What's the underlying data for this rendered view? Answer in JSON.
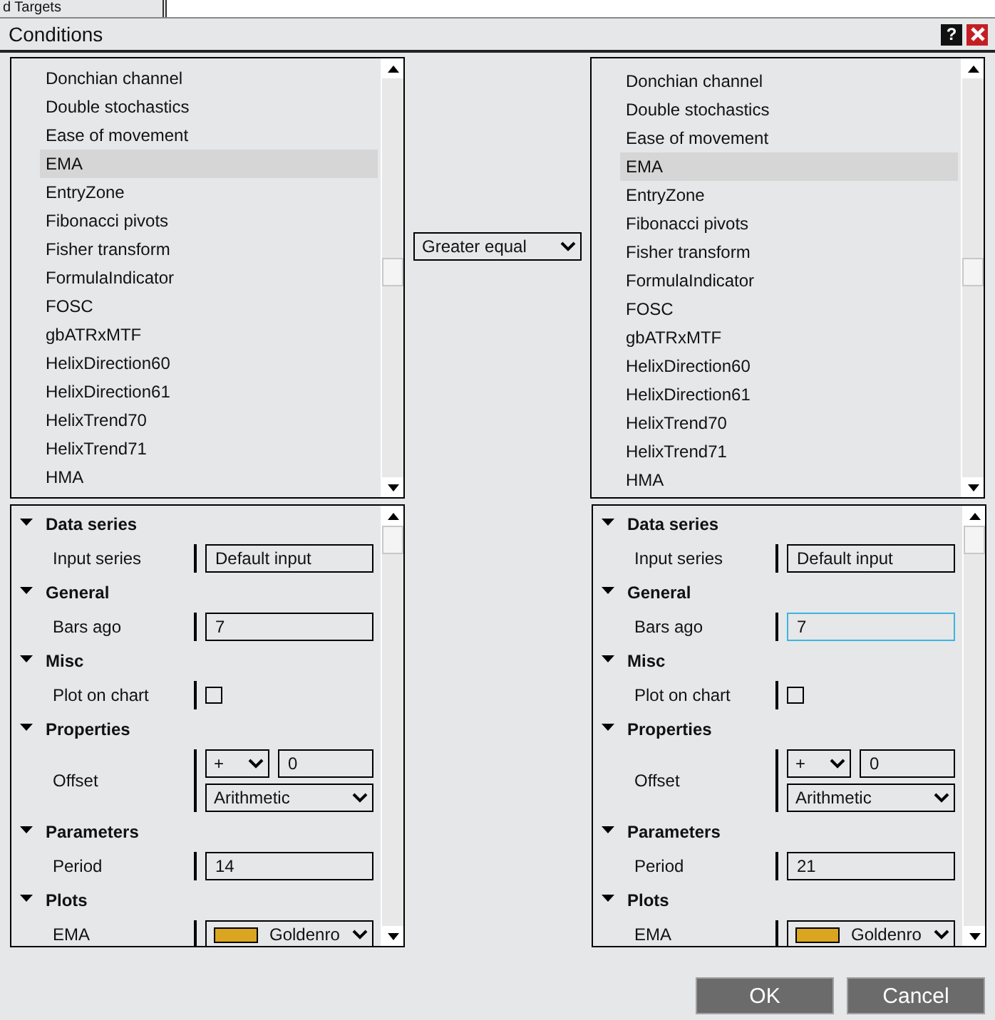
{
  "background_window": {
    "label": "d Targets"
  },
  "window": {
    "title": "Conditions",
    "help": "?"
  },
  "left": {
    "list": {
      "items": [
        {
          "label": "Donchian channel",
          "selected": false
        },
        {
          "label": "Double stochastics",
          "selected": false
        },
        {
          "label": "Ease of movement",
          "selected": false
        },
        {
          "label": "EMA",
          "selected": true
        },
        {
          "label": "EntryZone",
          "selected": false
        },
        {
          "label": "Fibonacci pivots",
          "selected": false
        },
        {
          "label": "Fisher transform",
          "selected": false
        },
        {
          "label": "FormulaIndicator",
          "selected": false
        },
        {
          "label": "FOSC",
          "selected": false
        },
        {
          "label": "gbATRxMTF",
          "selected": false
        },
        {
          "label": "HelixDirection60",
          "selected": false
        },
        {
          "label": "HelixDirection61",
          "selected": false
        },
        {
          "label": "HelixTrend70",
          "selected": false
        },
        {
          "label": "HelixTrend71",
          "selected": false
        },
        {
          "label": "HMA",
          "selected": false
        }
      ]
    },
    "properties": [
      {
        "name": "Data series",
        "expanded": true,
        "rows": [
          {
            "kind": "text",
            "label": "Input series",
            "value": "Default input",
            "focused": false
          }
        ]
      },
      {
        "name": "General",
        "expanded": true,
        "rows": [
          {
            "kind": "text",
            "label": "Bars ago",
            "value": "7",
            "focused": false
          }
        ]
      },
      {
        "name": "Misc",
        "expanded": true,
        "rows": [
          {
            "kind": "checkbox",
            "label": "Plot on chart",
            "checked": false
          }
        ]
      },
      {
        "name": "Properties",
        "expanded": true,
        "rows": [
          {
            "kind": "offset",
            "label": "Offset",
            "sign": "+",
            "value": "0",
            "mode": "Arithmetic"
          }
        ]
      },
      {
        "name": "Parameters",
        "expanded": true,
        "rows": [
          {
            "kind": "text",
            "label": "Period",
            "value": "14",
            "focused": false
          }
        ]
      },
      {
        "name": "Plots",
        "expanded": true,
        "rows": [
          {
            "kind": "color",
            "label": "EMA",
            "color": "#daa520",
            "value": "Goldenro"
          }
        ]
      }
    ]
  },
  "comparison": {
    "value": "Greater equal"
  },
  "right": {
    "list": {
      "items": [
        {
          "label": "Donchian channel",
          "selected": false
        },
        {
          "label": "Double stochastics",
          "selected": false
        },
        {
          "label": "Ease of movement",
          "selected": false
        },
        {
          "label": "EMA",
          "selected": true
        },
        {
          "label": "EntryZone",
          "selected": false
        },
        {
          "label": "Fibonacci pivots",
          "selected": false
        },
        {
          "label": "Fisher transform",
          "selected": false
        },
        {
          "label": "FormulaIndicator",
          "selected": false
        },
        {
          "label": "FOSC",
          "selected": false
        },
        {
          "label": "gbATRxMTF",
          "selected": false
        },
        {
          "label": "HelixDirection60",
          "selected": false
        },
        {
          "label": "HelixDirection61",
          "selected": false
        },
        {
          "label": "HelixTrend70",
          "selected": false
        },
        {
          "label": "HelixTrend71",
          "selected": false
        },
        {
          "label": "HMA",
          "selected": false
        }
      ]
    },
    "properties": [
      {
        "name": "Data series",
        "expanded": true,
        "rows": [
          {
            "kind": "text",
            "label": "Input series",
            "value": "Default input",
            "focused": false
          }
        ]
      },
      {
        "name": "General",
        "expanded": true,
        "rows": [
          {
            "kind": "text",
            "label": "Bars ago",
            "value": "7",
            "focused": true
          }
        ]
      },
      {
        "name": "Misc",
        "expanded": true,
        "rows": [
          {
            "kind": "checkbox",
            "label": "Plot on chart",
            "checked": false
          }
        ]
      },
      {
        "name": "Properties",
        "expanded": true,
        "rows": [
          {
            "kind": "offset",
            "label": "Offset",
            "sign": "+",
            "value": "0",
            "mode": "Arithmetic"
          }
        ]
      },
      {
        "name": "Parameters",
        "expanded": true,
        "rows": [
          {
            "kind": "text",
            "label": "Period",
            "value": "21",
            "focused": false
          }
        ]
      },
      {
        "name": "Plots",
        "expanded": true,
        "rows": [
          {
            "kind": "color",
            "label": "EMA",
            "color": "#daa520",
            "value": "Goldenro"
          }
        ]
      }
    ]
  },
  "buttons": [
    {
      "label": "OK"
    },
    {
      "label": "Cancel"
    }
  ]
}
